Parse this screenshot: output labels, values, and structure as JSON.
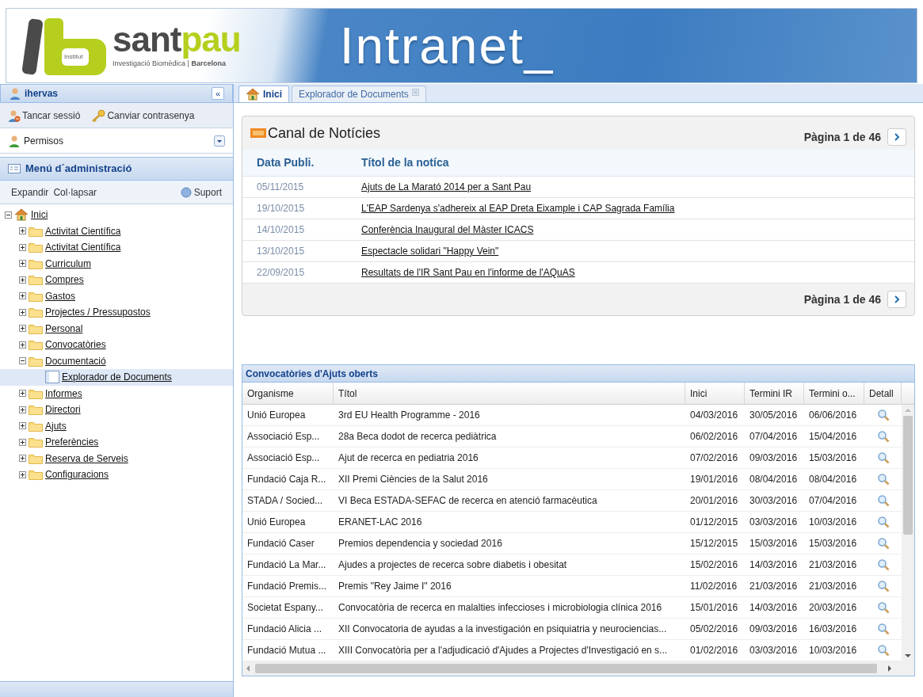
{
  "header": {
    "logo": {
      "badge": "Institut",
      "name": [
        "sant",
        "pau"
      ],
      "tagline": "Investigació Biomèdica | **Barcelona**"
    },
    "title": "Intranet_"
  },
  "sidebar": {
    "user": "ihervas",
    "collapse": "«",
    "actions": [
      {
        "kind": "logout",
        "label": "Tancar sessió"
      },
      {
        "kind": "password",
        "label": "Canviar contrasenya"
      }
    ],
    "role": {
      "value": "Permisos"
    },
    "menu_title": "Menú d´administració",
    "toolbar": {
      "links": [
        "Expandir",
        "Col·lapsar"
      ],
      "help": "Suport"
    },
    "tree": [
      {
        "label": "Inici",
        "kind": "home",
        "expanded": true,
        "selected": false,
        "children": [
          {
            "label": "Activitat Científica",
            "kind": "folder",
            "expanded": false,
            "selected": false
          },
          {
            "label": "Activitat Científica",
            "kind": "folder",
            "expanded": false,
            "selected": false
          },
          {
            "label": "Curriculum",
            "kind": "folder",
            "expanded": false,
            "selected": false
          },
          {
            "label": "Compres",
            "kind": "folder",
            "expanded": false,
            "selected": false
          },
          {
            "label": "Gastos",
            "kind": "folder",
            "expanded": false,
            "selected": false
          },
          {
            "label": "Projectes / Pressupostos",
            "kind": "folder",
            "expanded": false,
            "selected": false
          },
          {
            "label": "Personal",
            "kind": "folder",
            "expanded": false,
            "selected": false
          },
          {
            "label": "Convocatòries",
            "kind": "folder",
            "expanded": false,
            "selected": false
          },
          {
            "label": "Documentació",
            "kind": "folder",
            "expanded": true,
            "selected": false,
            "children": [
              {
                "label": "Explorador de Documents",
                "kind": "page",
                "selected": true
              }
            ]
          },
          {
            "label": "Informes",
            "kind": "folder",
            "expanded": false,
            "selected": false
          },
          {
            "label": "Directori",
            "kind": "folder",
            "expanded": false,
            "selected": false
          },
          {
            "label": "Ajuts",
            "kind": "folder",
            "expanded": false,
            "selected": false
          },
          {
            "label": "Preferències",
            "kind": "folder",
            "expanded": false,
            "selected": false
          },
          {
            "label": "Reserva de Serveis",
            "kind": "folder",
            "expanded": false,
            "selected": false
          },
          {
            "label": "Configuracions",
            "kind": "folder",
            "expanded": false,
            "selected": false
          }
        ]
      }
    ]
  },
  "tabs": [
    {
      "label": "Inici",
      "selected": true,
      "closable": false
    },
    {
      "label": "Explorador de Documents",
      "selected": false,
      "closable": true
    }
  ],
  "news": {
    "title": "Canal de Notícies",
    "page_top": "Pàgina 1 de 46",
    "page_bottom": "Pàgina 1 de 46",
    "columns": [
      "Data Publi.",
      "Títol de la notíca"
    ],
    "rows": [
      [
        "05/11/2015",
        "Ajuts de La Marató 2014 per a Sant Pau"
      ],
      [
        "19/10/2015",
        "L'EAP Sardenya s'adhereix al EAP Dreta Eixample i CAP Sagrada Família"
      ],
      [
        "14/10/2015",
        "Conferència Inaugural del Màster ICACS"
      ],
      [
        "13/10/2015",
        "Espectacle solidari \"Happy Vein\""
      ],
      [
        "22/09/2015",
        "Resultats de l'IR Sant Pau en l'informe de l'AQuAS"
      ]
    ]
  },
  "grants": {
    "title": "Convocatòries d'Ajuts oberts",
    "columns": [
      "Organisme",
      "Títol",
      "Inici",
      "Termini IR",
      "Termini o...",
      "Detall"
    ],
    "rows": [
      [
        "Unió Europea",
        "3rd EU Health Programme - 2016",
        "04/03/2016",
        "30/05/2016",
        "06/06/2016"
      ],
      [
        "Associació Esp...",
        "28a Beca dodot de recerca pediàtrica",
        "06/02/2016",
        "07/04/2016",
        "15/04/2016"
      ],
      [
        "Associació Esp...",
        "Ajut de recerca en pediatria 2016",
        "07/02/2016",
        "09/03/2016",
        "15/03/2016"
      ],
      [
        "Fundació Caja R...",
        "XII Premi Ciències de la Salut 2016",
        "19/01/2016",
        "08/04/2016",
        "08/04/2016"
      ],
      [
        "STADA / Socied...",
        "VI Beca ESTADA-SEFAC de recerca en atenció farmacèutica",
        "20/01/2016",
        "30/03/2016",
        "07/04/2016"
      ],
      [
        "Unió Europea",
        "ERANET-LAC 2016",
        "01/12/2015",
        "03/03/2016",
        "10/03/2016"
      ],
      [
        "Fundació Caser",
        "Premios dependencia y sociedad 2016",
        "15/12/2015",
        "15/03/2016",
        "15/03/2016"
      ],
      [
        "Fundació La Mar...",
        "Ajudes a projectes de recerca sobre diabetis i obesitat",
        "15/02/2016",
        "14/03/2016",
        "21/03/2016"
      ],
      [
        "Fundació Premis...",
        "Premis \"Rey Jaime I\" 2016",
        "11/02/2016",
        "21/03/2016",
        "21/03/2016"
      ],
      [
        "Societat Espany...",
        "Convocatòria de recerca en malalties infeccioses i microbiologia clínica 2016",
        "15/01/2016",
        "14/03/2016",
        "20/03/2016"
      ],
      [
        "Fundació Alicia ...",
        "XII Convocatoria de ayudas a la investigación en psiquiatria y neurociencias...",
        "05/02/2016",
        "09/03/2016",
        "16/03/2016"
      ],
      [
        "Fundació Mutua ...",
        "XIII Convocatòria per a l'adjudicació d'Ajudes a Projectes d'Investigació en s...",
        "01/02/2016",
        "03/03/2016",
        "10/03/2016"
      ]
    ]
  }
}
